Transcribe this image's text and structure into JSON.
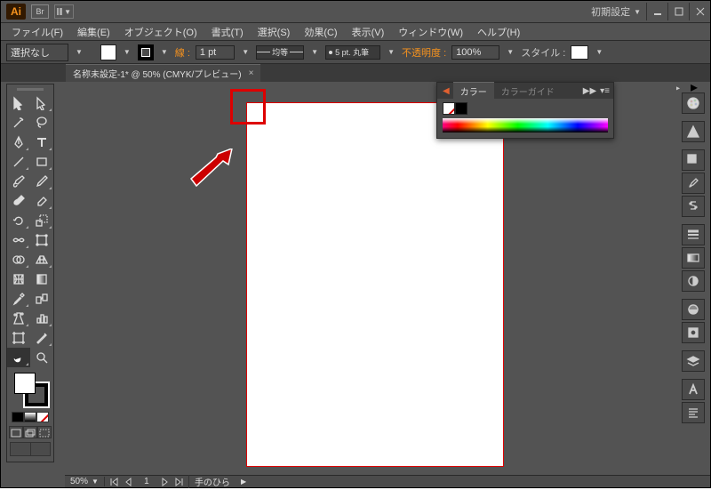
{
  "titlebar": {
    "ai": "Ai",
    "br": "Br",
    "workspace": "初期設定"
  },
  "menu": {
    "file": "ファイル(F)",
    "edit": "編集(E)",
    "object": "オブジェクト(O)",
    "type": "書式(T)",
    "select": "選択(S)",
    "effect": "効果(C)",
    "view": "表示(V)",
    "window": "ウィンドウ(W)",
    "help": "ヘルプ(H)"
  },
  "options": {
    "selection": "選択なし",
    "stroke_label": "線 :",
    "stroke_weight": "1 pt",
    "profile_label": "均等",
    "brush_label": "5 pt. 丸筆",
    "opacity_label": "不透明度 :",
    "opacity_value": "100%",
    "style_label": "スタイル :"
  },
  "doc": {
    "tab_title": "名称未設定-1* @ 50% (CMYK/プレビュー)"
  },
  "color_panel": {
    "tab_color": "カラー",
    "tab_guide": "カラーガイド"
  },
  "status": {
    "zoom": "50%",
    "artboard_num": "1",
    "tool_name": "手のひら"
  }
}
